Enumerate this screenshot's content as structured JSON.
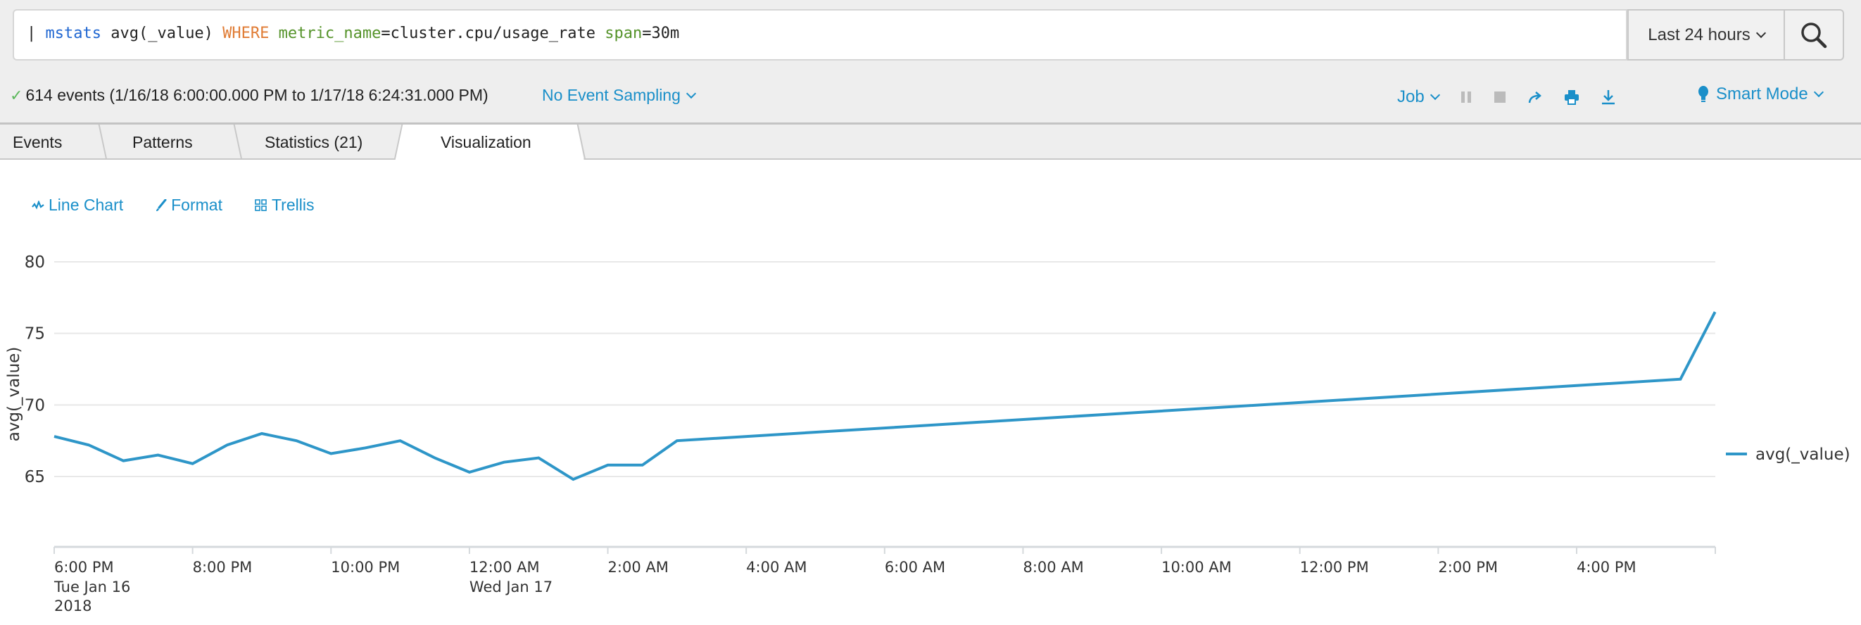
{
  "search": {
    "pipe": "| ",
    "command": "mstats",
    "arg": " avg(_value) ",
    "where": "WHERE",
    "field1": " metric_name",
    "value1": "=cluster.cpu/usage_rate ",
    "field2": "span",
    "value2": "=30m"
  },
  "time_picker": {
    "label": "Last 24 hours"
  },
  "status": {
    "text": "614 events (1/16/18 6:00:00.000 PM to 1/17/18 6:24:31.000 PM)",
    "sampling": "No Event Sampling"
  },
  "job_bar": {
    "job_label": "Job",
    "mode_label": "Smart Mode"
  },
  "tabs": [
    {
      "label": "Events"
    },
    {
      "label": "Patterns"
    },
    {
      "label": "Statistics (21)"
    },
    {
      "label": "Visualization",
      "active": true
    }
  ],
  "viz_toolbar": {
    "line_chart": "Line Chart",
    "format": "Format",
    "trellis": "Trellis"
  },
  "colors": {
    "accent": "#1a8fc9",
    "series": "#2e96c8",
    "grid": "#e8e8e8"
  },
  "chart_data": {
    "type": "line",
    "title": "",
    "xlabel": "",
    "ylabel": "avg(_value)",
    "ylim": [
      60,
      80
    ],
    "yticks": [
      65,
      70,
      75,
      80
    ],
    "x_range": [
      "2018-01-16T18:00",
      "2018-01-17T18:00"
    ],
    "xticks": [
      {
        "label": "6:00 PM",
        "sub": [
          "Tue Jan 16",
          "2018"
        ],
        "t": 0
      },
      {
        "label": "8:00 PM",
        "sub": [],
        "t": 2
      },
      {
        "label": "10:00 PM",
        "sub": [],
        "t": 4
      },
      {
        "label": "12:00 AM",
        "sub": [
          "Wed Jan 17"
        ],
        "t": 6
      },
      {
        "label": "2:00 AM",
        "sub": [],
        "t": 8
      },
      {
        "label": "4:00 AM",
        "sub": [],
        "t": 10
      },
      {
        "label": "6:00 AM",
        "sub": [],
        "t": 12
      },
      {
        "label": "8:00 AM",
        "sub": [],
        "t": 14
      },
      {
        "label": "10:00 AM",
        "sub": [],
        "t": 16
      },
      {
        "label": "12:00 PM",
        "sub": [],
        "t": 18
      },
      {
        "label": "2:00 PM",
        "sub": [],
        "t": 20
      },
      {
        "label": "4:00 PM",
        "sub": [],
        "t": 22
      }
    ],
    "grid": true,
    "legend": "right",
    "series": [
      {
        "name": "avg(_value)",
        "x_hours": [
          0,
          0.5,
          1,
          1.5,
          2,
          2.5,
          3,
          3.5,
          4,
          4.5,
          5,
          5.5,
          6,
          6.5,
          7,
          7.5,
          8,
          8.5,
          9,
          23.5,
          24
        ],
        "x_labels": [
          "6:00 PM",
          "6:30 PM",
          "7:00 PM",
          "7:30 PM",
          "8:00 PM",
          "8:30 PM",
          "9:00 PM",
          "9:30 PM",
          "10:00 PM",
          "10:30 PM",
          "11:00 PM",
          "11:30 PM",
          "12:00 AM",
          "12:30 AM",
          "1:00 AM",
          "1:30 AM",
          "2:00 AM",
          "2:30 AM",
          "3:00 AM",
          "5:30 PM",
          "6:00 PM"
        ],
        "values": [
          67.8,
          67.2,
          66.1,
          66.5,
          65.9,
          67.2,
          68.0,
          67.5,
          66.6,
          67.0,
          67.5,
          66.3,
          65.3,
          66.0,
          66.3,
          64.8,
          65.8,
          65.8,
          67.5,
          71.8,
          76.5
        ]
      }
    ]
  }
}
